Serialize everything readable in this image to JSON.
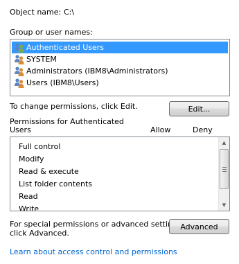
{
  "object": {
    "label": "Object name:",
    "value": "C:\\"
  },
  "group_section": {
    "label": "Group or user names:",
    "items": [
      {
        "name": "Authenticated Users",
        "selected": true
      },
      {
        "name": "SYSTEM",
        "selected": false
      },
      {
        "name": "Administrators (IBM8\\Administrators)",
        "selected": false
      },
      {
        "name": "Users (IBM8\\Users)",
        "selected": false
      }
    ]
  },
  "change_text": "To change permissions, click Edit.",
  "edit_button": "Edit...",
  "permissions": {
    "header_line1": "Permissions for Authenticated",
    "header_line2": "Users",
    "allow_label": "Allow",
    "deny_label": "Deny",
    "rows": [
      "Full control",
      "Modify",
      "Read & execute",
      "List folder contents",
      "Read",
      "Write"
    ]
  },
  "special": {
    "line1": "For special permissions or advanced settings,",
    "line2": "click Advanced."
  },
  "advanced_button": "Advanced",
  "learn_link": "Learn about access control and permissions",
  "icons": {
    "user": "user-group-icon",
    "scroll_up": "scroll-up-arrow-icon",
    "scroll_down": "scroll-down-arrow-icon"
  }
}
